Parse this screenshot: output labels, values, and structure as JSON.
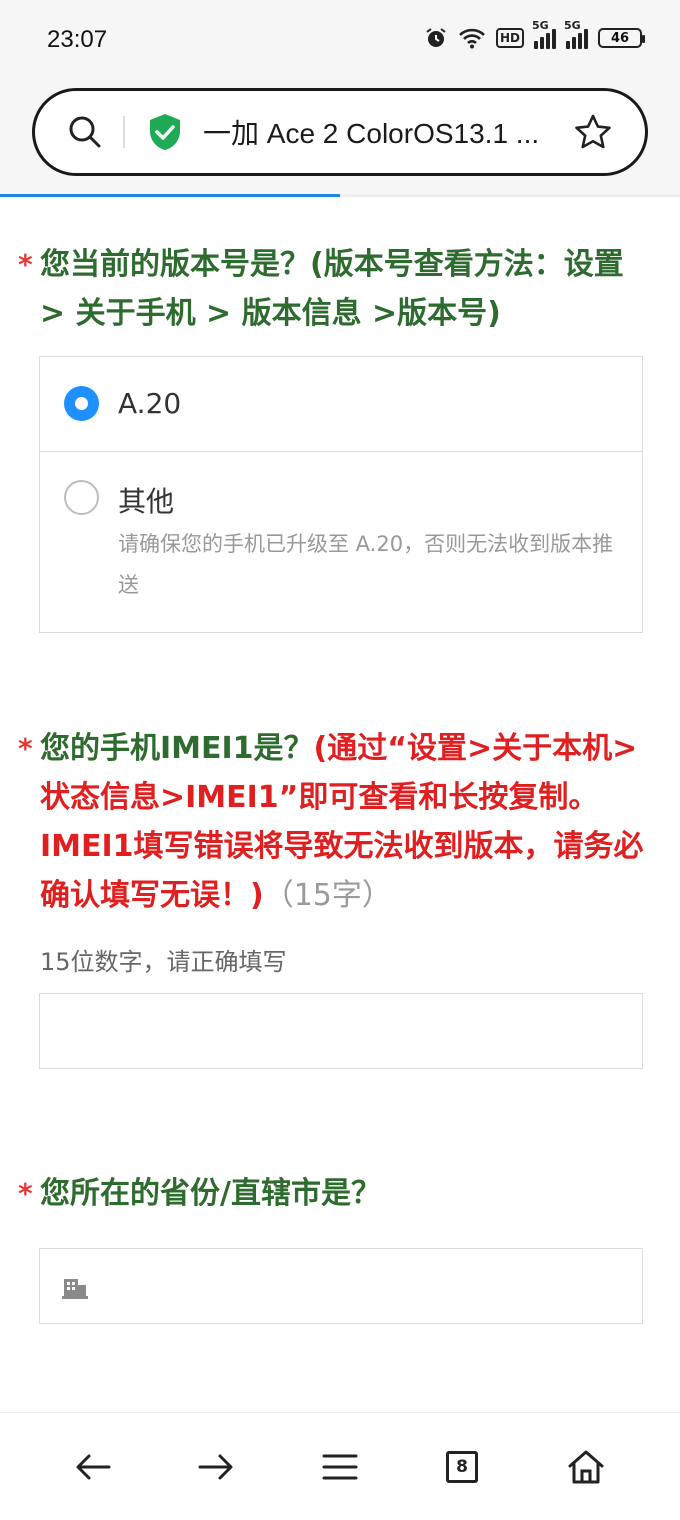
{
  "status_bar": {
    "time": "23:07",
    "hd_label": "HD",
    "net1": "5G",
    "net2": "5G",
    "battery": "46"
  },
  "address_bar": {
    "page_title": "一加 Ace 2 ColorOS13.1 ...",
    "load_progress_percent": 50
  },
  "form": {
    "q1": {
      "required_mark": "*",
      "title": "您当前的版本号是？(版本号查看方法：设置 > 关于手机 > 版本信息 >版本号)",
      "options": [
        {
          "label": "A.20",
          "selected": true
        },
        {
          "label": "其他",
          "selected": false,
          "hint": "请确保您的手机已升级至 A.20，否则无法收到版本推送"
        }
      ]
    },
    "q2": {
      "required_mark": "*",
      "title_main": "您的手机IMEI1是？",
      "title_red": "(通过“设置>关于本机>状态信息>IMEI1”即可查看和长按复制。IMEI1填写错误将导致无法收到版本，请务必确认填写无误！)",
      "title_count": "（15字）",
      "hint": "15位数字，请正确填写",
      "value": ""
    },
    "q3": {
      "required_mark": "*",
      "title": "您所在的省份/直辖市是？",
      "value": "",
      "icon": "building-icon"
    }
  },
  "bottom_nav": {
    "tab_count": "8",
    "icons": [
      "back-arrow-icon",
      "forward-arrow-icon",
      "menu-icon",
      "tabs-icon",
      "home-icon"
    ]
  },
  "colors": {
    "question_green": "#2e6b2e",
    "required_red": "#e53935",
    "radio_blue": "#1e90ff",
    "progress_blue": "#1e88e5"
  }
}
